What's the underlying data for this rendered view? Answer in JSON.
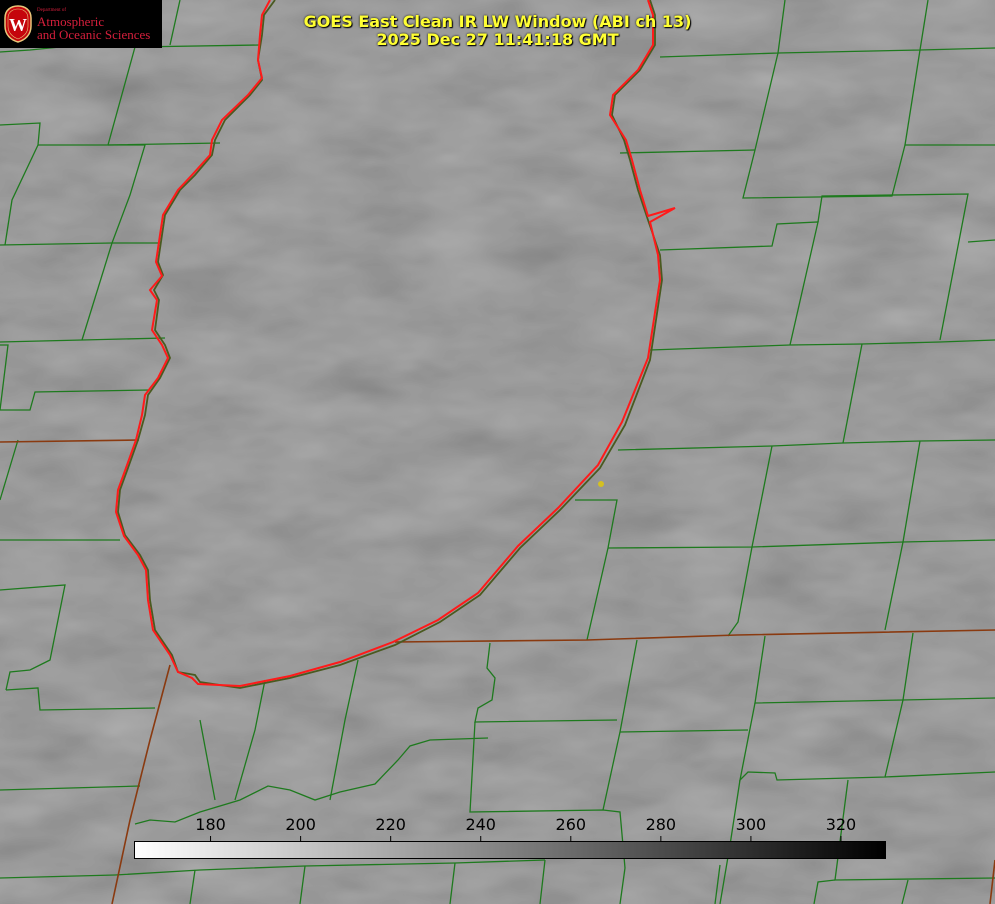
{
  "header": {
    "title_line1": "GOES East Clean IR LW Window (ABI ch 13)",
    "title_line2": "2025 Dec 27 11:41:18 GMT"
  },
  "logo": {
    "dept": "Department of",
    "line1": "Atmospheric",
    "line2": "and Oceanic Sciences",
    "seal_letter": "W"
  },
  "colorbar": {
    "ticks": [
      "180",
      "200",
      "220",
      "240",
      "260",
      "280",
      "300",
      "320"
    ],
    "tick_values": [
      180,
      200,
      220,
      240,
      260,
      280,
      300,
      320
    ],
    "range": [
      163,
      330
    ],
    "gradient": [
      "#ffffff",
      "#000000"
    ]
  },
  "colors": {
    "county_lines": "#1e7a1e",
    "state_lines": "#8a3a10",
    "lake_outline": "#ff1a1a",
    "title": "#ffff33",
    "marker": "#d4c020"
  }
}
